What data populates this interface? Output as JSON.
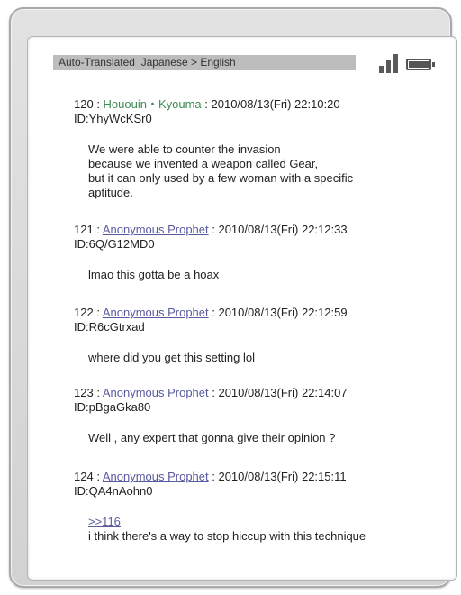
{
  "header": {
    "status_text": "Auto-Translated  Japanese > English",
    "signal_icon": "signal-icon",
    "battery_icon": "battery-icon"
  },
  "posts": [
    {
      "number": "120",
      "name": "Hououin・Kyouma",
      "datetime": "2010/08/13(Fri) 22:10:20",
      "id": "ID:YhyWcKSr0",
      "lines": [
        "We were able to counter the invasion",
        "because we invented a weapon called Gear,",
        "but it can only used by a few woman with a specific",
        "aptitude."
      ]
    },
    {
      "number": "121",
      "name": "Anonymous Prophet",
      "datetime": "2010/08/13(Fri) 22:12:33",
      "id": "ID:6Q/G12MD0",
      "lines": [
        "lmao this gotta be a hoax"
      ]
    },
    {
      "number": "122",
      "name": "Anonymous Prophet",
      "datetime": "2010/08/13(Fri) 22:12:59",
      "id": "ID:R6cGtrxad",
      "lines": [
        "where did you get this setting lol"
      ]
    },
    {
      "number": "123",
      "name": "Anonymous Prophet",
      "datetime": "2010/08/13(Fri) 22:14:07",
      "id": "ID:pBgaGka80",
      "lines": [
        "Well , any expert that gonna give their opinion ?"
      ]
    },
    {
      "number": "124",
      "name": "Anonymous Prophet",
      "datetime": "2010/08/13(Fri) 22:15:11",
      "id": "ID:QA4nAohn0",
      "reply_link": ">>116",
      "lines": [
        "i think there's a way to stop hiccup with this technique"
      ]
    }
  ],
  "colors": {
    "green_name": "#3e8a55",
    "link_name": "#5a5aa0"
  }
}
